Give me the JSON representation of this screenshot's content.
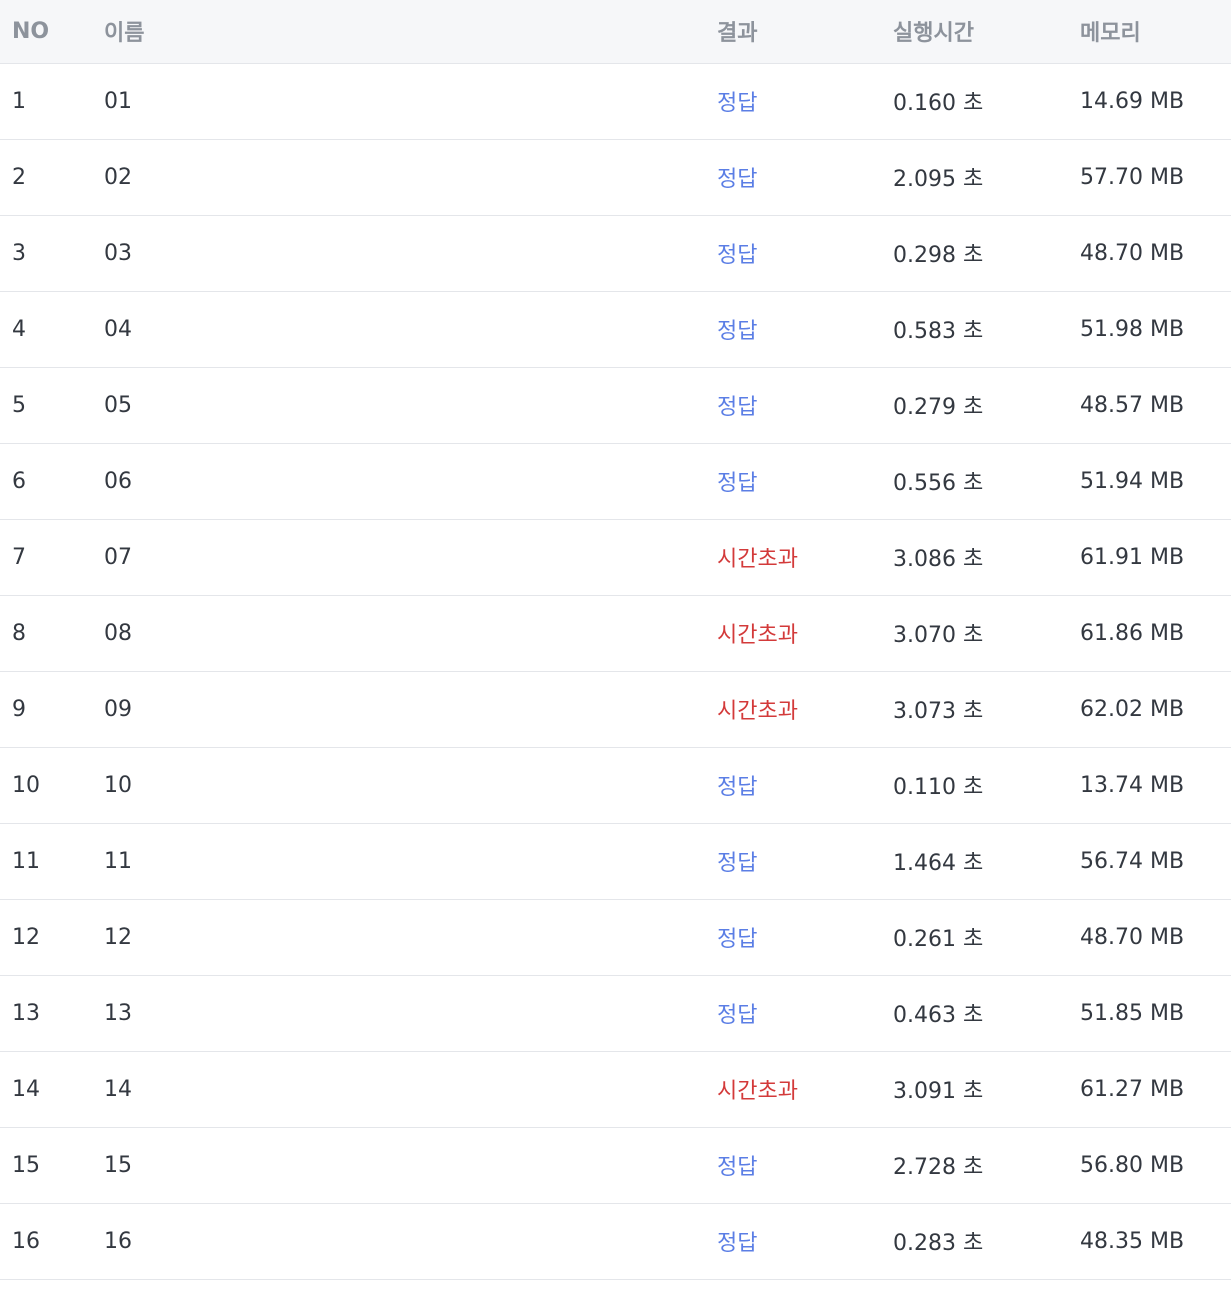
{
  "table": {
    "headers": {
      "no": "NO",
      "name": "이름",
      "result": "결과",
      "time": "실행시간",
      "memory": "메모리"
    },
    "status_colors": {
      "pass": "#5b7ee5",
      "tle": "#d33a3a",
      "header_text": "#8d939c",
      "header_bg": "#f6f7f9"
    },
    "rows": [
      {
        "no": "1",
        "name": "01",
        "result": "정답",
        "status": "pass",
        "time": "0.160 초",
        "memory": "14.69 MB"
      },
      {
        "no": "2",
        "name": "02",
        "result": "정답",
        "status": "pass",
        "time": "2.095 초",
        "memory": "57.70 MB"
      },
      {
        "no": "3",
        "name": "03",
        "result": "정답",
        "status": "pass",
        "time": "0.298 초",
        "memory": "48.70 MB"
      },
      {
        "no": "4",
        "name": "04",
        "result": "정답",
        "status": "pass",
        "time": "0.583 초",
        "memory": "51.98 MB"
      },
      {
        "no": "5",
        "name": "05",
        "result": "정답",
        "status": "pass",
        "time": "0.279 초",
        "memory": "48.57 MB"
      },
      {
        "no": "6",
        "name": "06",
        "result": "정답",
        "status": "pass",
        "time": "0.556 초",
        "memory": "51.94 MB"
      },
      {
        "no": "7",
        "name": "07",
        "result": "시간초과",
        "status": "tle",
        "time": "3.086 초",
        "memory": "61.91 MB"
      },
      {
        "no": "8",
        "name": "08",
        "result": "시간초과",
        "status": "tle",
        "time": "3.070 초",
        "memory": "61.86 MB"
      },
      {
        "no": "9",
        "name": "09",
        "result": "시간초과",
        "status": "tle",
        "time": "3.073 초",
        "memory": "62.02 MB"
      },
      {
        "no": "10",
        "name": "10",
        "result": "정답",
        "status": "pass",
        "time": "0.110 초",
        "memory": "13.74 MB"
      },
      {
        "no": "11",
        "name": "11",
        "result": "정답",
        "status": "pass",
        "time": "1.464 초",
        "memory": "56.74 MB"
      },
      {
        "no": "12",
        "name": "12",
        "result": "정답",
        "status": "pass",
        "time": "0.261 초",
        "memory": "48.70 MB"
      },
      {
        "no": "13",
        "name": "13",
        "result": "정답",
        "status": "pass",
        "time": "0.463 초",
        "memory": "51.85 MB"
      },
      {
        "no": "14",
        "name": "14",
        "result": "시간초과",
        "status": "tle",
        "time": "3.091 초",
        "memory": "61.27 MB"
      },
      {
        "no": "15",
        "name": "15",
        "result": "정답",
        "status": "pass",
        "time": "2.728 초",
        "memory": "56.80 MB"
      },
      {
        "no": "16",
        "name": "16",
        "result": "정답",
        "status": "pass",
        "time": "0.283 초",
        "memory": "48.35 MB"
      }
    ]
  }
}
